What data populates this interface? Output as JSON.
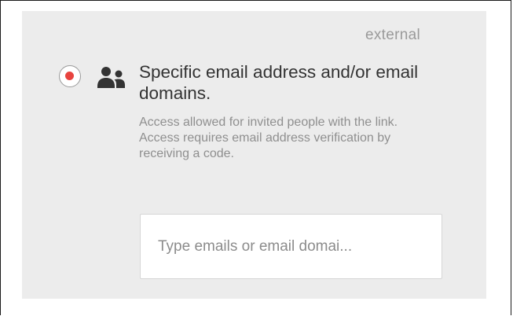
{
  "panel": {
    "partial_label": "external"
  },
  "option": {
    "selected": true,
    "icon": "people-icon",
    "title": "Specific email address and/or email domains.",
    "description": "Access allowed for invited people with the link. Access requires email address verification by receiving a code."
  },
  "email_input": {
    "value": "",
    "placeholder": "Type emails or email domai..."
  },
  "colors": {
    "radio_selected": "#e8443f",
    "panel_background": "#ececec",
    "title_text": "#333333",
    "description_text": "#8f8f8f"
  }
}
